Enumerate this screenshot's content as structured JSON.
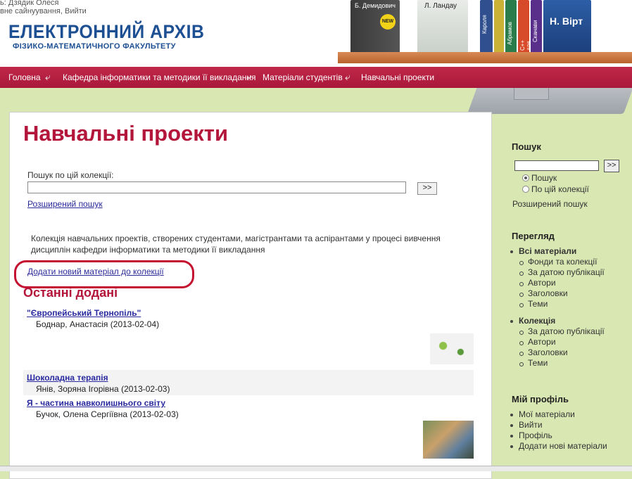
{
  "header": {
    "user_line_1": "ь: Дзядик Олеся",
    "user_line_2": "вне сайнуування, Вийти",
    "logo_title": "ЕЛЕКТРОННИЙ АРХІВ",
    "logo_subtitle": "ФІЗИКО-МАТЕМАТИЧНОГО ФАКУЛЬТЕТУ",
    "books": [
      "Б. Демидович",
      "Л. Ландау",
      "Кароля",
      "Сканави",
      "С++ для чайника",
      "Абрамов",
      "Н. Вірт"
    ],
    "book_badge": "NEW"
  },
  "nav": {
    "items": [
      "Головна",
      "Кафедра інформатики та методики її викладання",
      "Матеріали студентів",
      "Навчальні проекти"
    ]
  },
  "main": {
    "title": "Навчальні проекти",
    "search_label": "Пошук по цій колекції:",
    "search_button": ">>",
    "advanced_search": "Розширений пошук",
    "description": "Колекція навчальних проектів, створених студентами, магістрантами та аспірантами у процесі вивчення дисциплін кафедри інформатики та методики її викладання",
    "add_link": "Додати новий матеріал до колекції",
    "recent_title": "Останні додані",
    "recent": [
      {
        "title": "\"Європейський Тернопіль\"",
        "author": "Боднар, Анастасія (2013-02-04)"
      },
      {
        "title": "Шоколадна терапія",
        "author": "Янів, Зоряна Ігорівна (2013-02-03)"
      },
      {
        "title": "Я - частина навколишнього світу",
        "author": "Бучок, Олена Сергіївна (2013-02-03)"
      }
    ]
  },
  "sidebar": {
    "search_head": "Пошук",
    "search_button": ">>",
    "radio_all": "Пошук",
    "radio_collection": "По цій колекції",
    "advanced_search": "Розширений пошук",
    "browse_head": "Перегляд",
    "all_materials": "Всі матеріали",
    "all_items": [
      "Фонди та колекції",
      "За датою публікації",
      "Автори",
      "Заголовки",
      "Теми"
    ],
    "collection": "Колекція",
    "collection_items": [
      "За датою публікації",
      "Автори",
      "Заголовки",
      "Теми"
    ],
    "profile_head": "Мій профіль",
    "profile_items": [
      "Мої матеріали",
      "Вийти",
      "Профіль",
      "Додати нові матеріали"
    ]
  },
  "colors": {
    "accent": "#b3163a",
    "nav": "#b81f41",
    "page_bg": "#d9e7b3",
    "link": "#2a2a9a"
  }
}
